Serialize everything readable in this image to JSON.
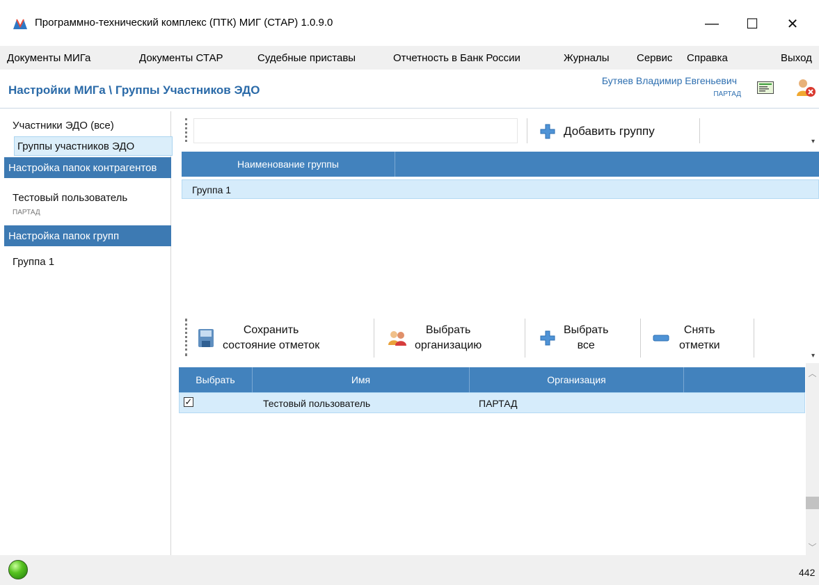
{
  "window": {
    "title": "Программно-технический комплекс (ПТК) МИГ (СТАР) 1.0.9.0",
    "minimize": "—",
    "maximize": "☐",
    "close": "✕"
  },
  "menu": [
    "Документы МИГа",
    "Документы СТАР",
    "Судебные приставы",
    "Отчетность в Банк России",
    "Журналы",
    "Сервис",
    "Справка",
    "Выход"
  ],
  "header": {
    "title": "Настройки МИГа \\ Группы Участников ЭДО",
    "user_name": "Бутяев Владимир Евгеньевич",
    "user_org": "ПАРТАД"
  },
  "sidebar": {
    "all_participants": "Участники ЭДО (все)",
    "participant_groups": "Группы участников ЭДО",
    "contractor_folders_header": "Настройка папок контрагентов",
    "test_user": "Тестовый пользователь",
    "test_user_org": "ПАРТАД",
    "group_folders_header": "Настройка папок групп",
    "group_item": "Группа 1"
  },
  "groups_toolbar": {
    "search_value": "",
    "add_group_label": "Добавить группу"
  },
  "groups_grid": {
    "columns": [
      "Наименование группы"
    ],
    "rows": [
      [
        "Группа 1"
      ]
    ]
  },
  "members_toolbar": {
    "save_line1": "Сохранить",
    "save_line2": "состояние отметок",
    "choose_org_line1": "Выбрать",
    "choose_org_line2": "организацию",
    "select_all_line1": "Выбрать",
    "select_all_line2": "все",
    "clear_line1": "Снять",
    "clear_line2": "отметки"
  },
  "members_grid": {
    "columns": [
      "Выбрать",
      "Имя",
      "Организация"
    ],
    "rows": [
      {
        "checked": "✓",
        "name": "Тестовый пользователь",
        "org": "ПАРТАД"
      }
    ]
  },
  "status": {
    "number": "442"
  },
  "colors": {
    "accent": "#4282bd",
    "sidebar_header": "#3d7ab3",
    "selection": "#d6ecfb",
    "title": "#2a6aa8"
  }
}
